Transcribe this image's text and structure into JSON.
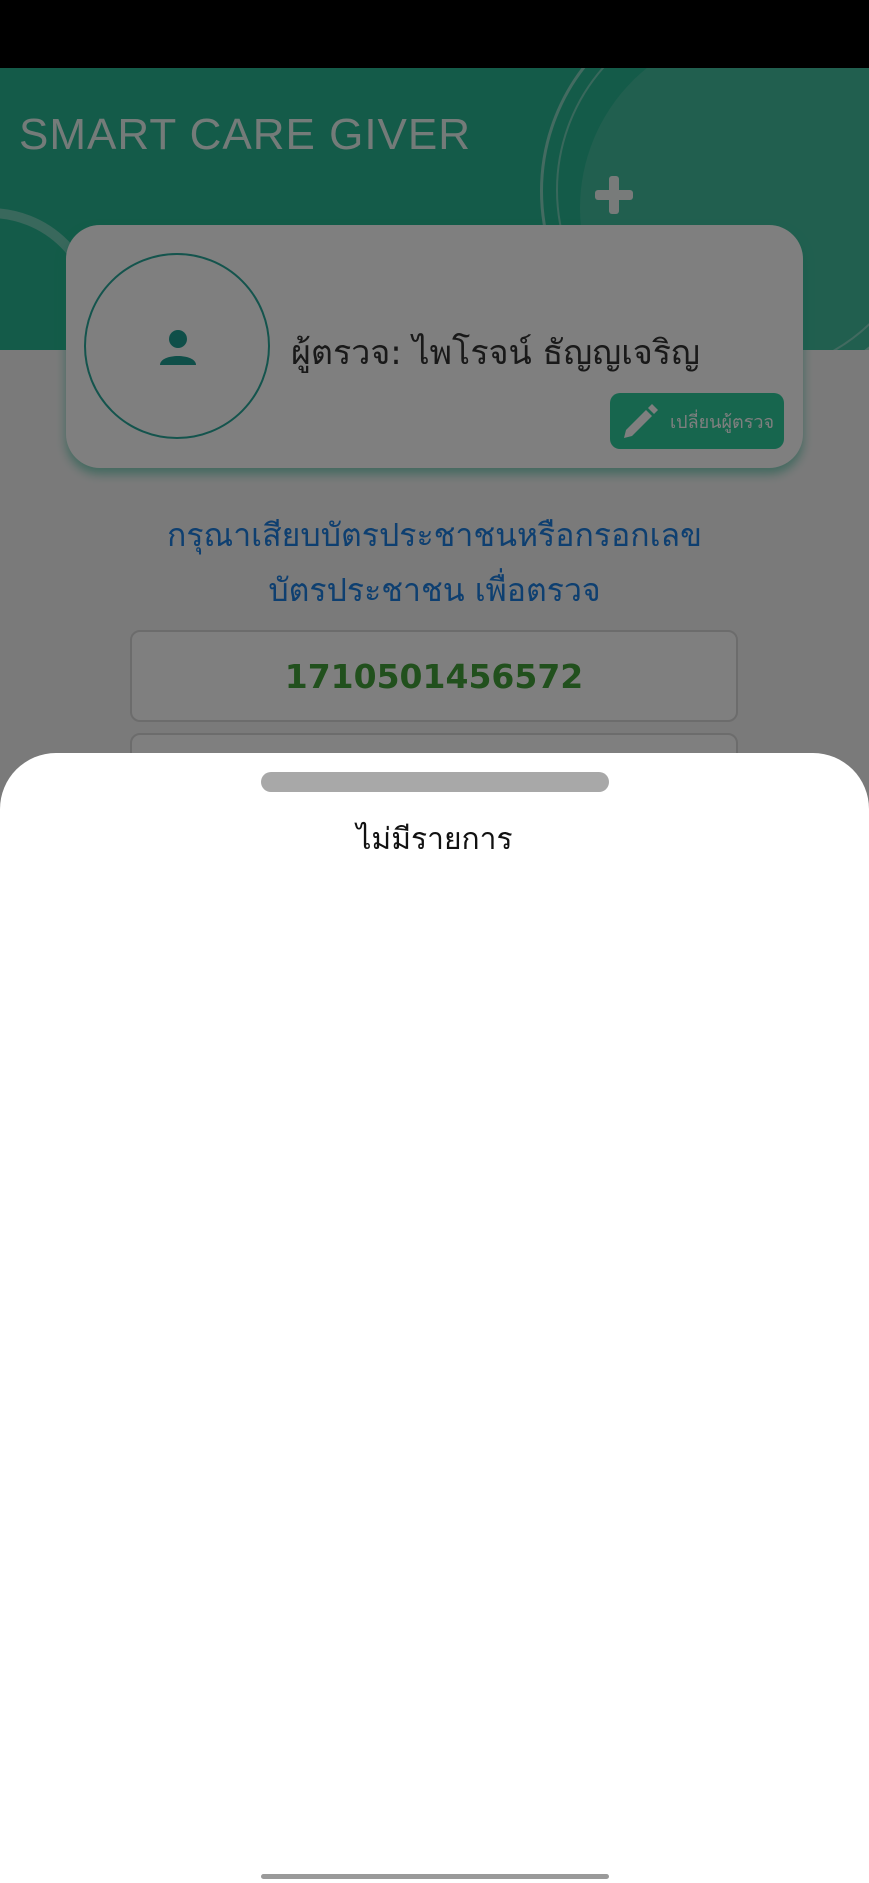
{
  "app": {
    "title": "SMART CARE GIVER"
  },
  "inspector": {
    "name": "ผู้ตรวจ: ไพโรจน์ ธัญญเจริญ",
    "change_label": "เปลี่ยนผู้ตรวจ"
  },
  "instruction": {
    "line1": "กรุณาเสียบบัตรประชาชนหรือกรอกเลข",
    "line2": "บัตรประชาชน เพื่อตรวจ"
  },
  "id_field": {
    "value": "1710501456572"
  },
  "sheet": {
    "empty_text": "ไม่มีรายการ"
  },
  "colors": {
    "header": "#28b792",
    "button": "#2ecc9c",
    "instruction_text": "#1c7fe0",
    "id_text": "#43a03a",
    "overlay": "rgba(0,0,0,0.5)"
  },
  "icons": {
    "avatar": "person-icon",
    "change": "pencil-icon",
    "header_decoration": "plus-icon"
  }
}
